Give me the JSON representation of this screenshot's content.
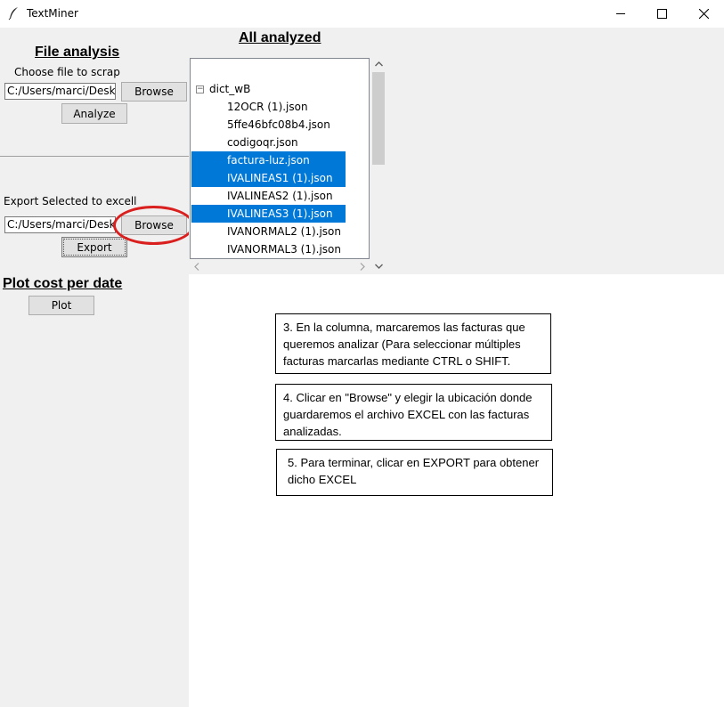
{
  "window": {
    "title": "TextMiner",
    "icon": "feather-icon",
    "controls": [
      "minimize-icon",
      "maximize-icon",
      "close-icon"
    ]
  },
  "file_analysis": {
    "heading": "File analysis",
    "choose_label": "Choose file to scrap",
    "path_value": "C:/Users/marci/Deskto",
    "browse_label": "Browse",
    "analyze_label": "Analyze"
  },
  "export": {
    "label": "Export Selected to excell",
    "path_value": "C:/Users/marci/Deskto",
    "browse_label": "Browse",
    "export_label": "Export"
  },
  "plot": {
    "heading": "Plot cost per date",
    "plot_label": "Plot"
  },
  "all_analyzed": {
    "heading": "All analyzed",
    "root": {
      "label": "dict_wB",
      "toggle": "⊟"
    },
    "items": [
      {
        "label": "12OCR (1).json",
        "selected": false
      },
      {
        "label": "5ffe46bfc08b4.json",
        "selected": false
      },
      {
        "label": "codigoqr.json",
        "selected": false
      },
      {
        "label": "factura-luz.json",
        "selected": true
      },
      {
        "label": "IVALINEAS1 (1).json",
        "selected": true
      },
      {
        "label": "IVALINEAS2 (1).json",
        "selected": false
      },
      {
        "label": "IVALINEAS3 (1).json",
        "selected": true
      },
      {
        "label": "IVANORMAL2 (1).json",
        "selected": false
      },
      {
        "label": "IVANORMAL3 (1).json",
        "selected": false
      }
    ]
  },
  "notes": {
    "step3": "3. En la columna, marcaremos las facturas que queremos analizar (Para seleccionar múltiples facturas marcarlas mediante CTRL o SHIFT.",
    "step4": "4. Clicar en \"Browse\" y elegir la ubicación donde guardaremos el archivo EXCEL con las facturas analizadas.",
    "step5": "5. Para terminar, clicar en EXPORT para obtener dicho EXCEL"
  },
  "colors": {
    "selection": "#0078d7",
    "highlight_ellipse": "#d9201f",
    "panel_bg": "#f0f0f0"
  }
}
